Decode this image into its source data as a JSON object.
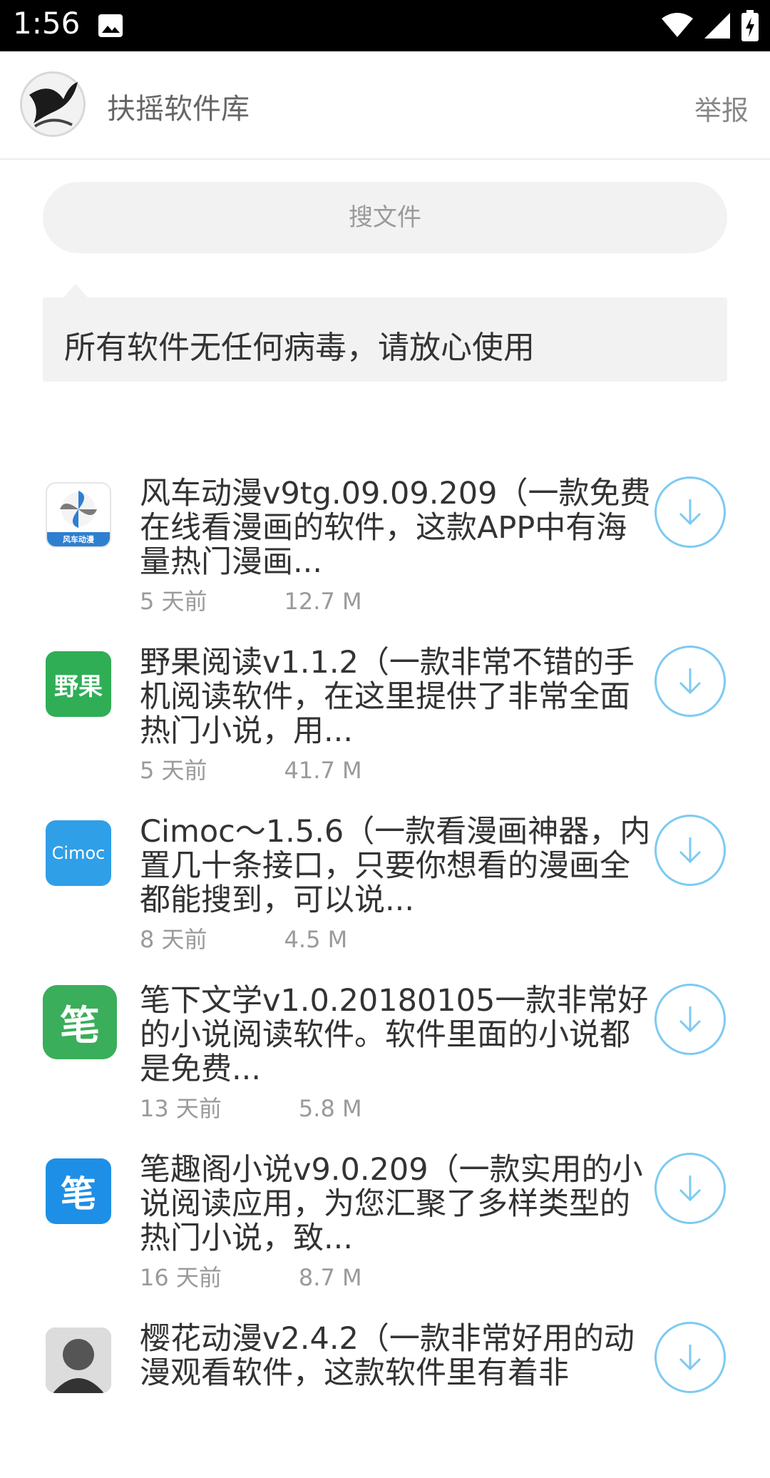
{
  "status_bar": {
    "time": "1:56"
  },
  "header": {
    "title": "扶摇软件库",
    "report_label": "举报"
  },
  "search": {
    "placeholder": "搜文件"
  },
  "notice": {
    "text": "所有软件无任何病毒，请放心使用"
  },
  "apps": [
    {
      "icon_text": "风车动漫",
      "icon_color": "#ffffff",
      "title": "风车动漫v9tg.09.09.209（一款免费在线看漫画的软件，这款APP中有海量热门漫画...",
      "time": "5 天前",
      "size": "12.7 M"
    },
    {
      "icon_text": "野果",
      "icon_color": "#2fae56",
      "title": "野果阅读v1.1.2（一款非常不错的手机阅读软件，在这里提供了非常全面热门小说，用...",
      "time": "5 天前",
      "size": "41.7 M"
    },
    {
      "icon_text": "Cimoc",
      "icon_color": "#2f9fe8",
      "title": "Cimoc～1.5.6（一款看漫画神器，内置几十条接口，只要你想看的漫画全都能搜到，可以说...",
      "time": "8 天前",
      "size": "4.5 M"
    },
    {
      "icon_text": "笔",
      "icon_color": "#3aae5a",
      "title": "笔下文学v1.0.20180105一款非常好的小说阅读软件。软件里面的小说都是免费...",
      "time": "13 天前",
      "size": "5.8 M"
    },
    {
      "icon_text": "笔",
      "icon_color": "#1e8fe6",
      "title": "笔趣阁小说v9.0.209（一款实用的小说阅读应用，为您汇聚了多样类型的热门小说，致...",
      "time": "16 天前",
      "size": "8.7 M"
    },
    {
      "icon_text": "",
      "icon_color": "#777777",
      "title": "樱花动漫v2.4.2（一款非常好用的动漫观看软件，这款软件里有着非",
      "time": "",
      "size": ""
    }
  ]
}
